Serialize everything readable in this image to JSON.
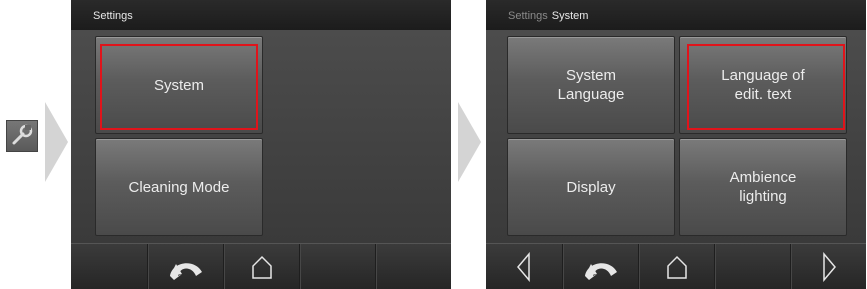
{
  "screen1": {
    "title": "Settings",
    "tiles": [
      "System",
      "Cleaning Mode"
    ]
  },
  "screen2": {
    "breadcrumb_parent": "Settings",
    "title": "System",
    "tiles": [
      "System\nLanguage",
      "Language of\nedit. text",
      "Display",
      "Ambience\nlighting"
    ]
  },
  "icons": {
    "settings": "wrench-icon",
    "back": "back-arrow-icon",
    "home": "home-icon",
    "prev": "chevron-left-icon",
    "next": "chevron-right-icon"
  },
  "colors": {
    "highlight": "#e0141b",
    "screen_bg": "#2c2c2c"
  }
}
